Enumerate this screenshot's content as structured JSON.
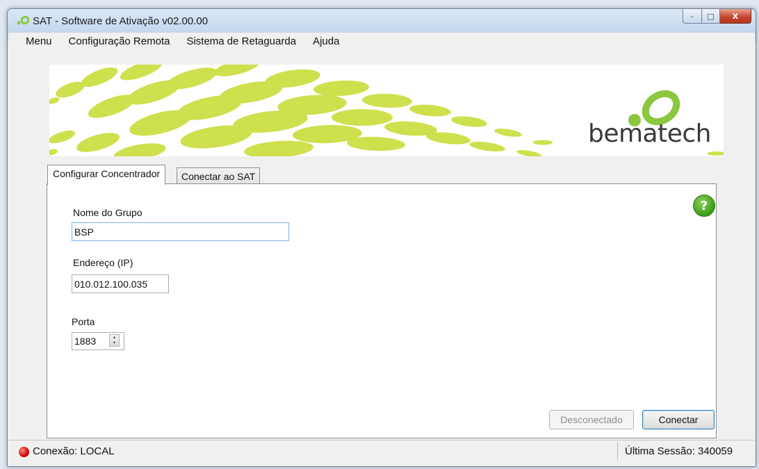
{
  "window": {
    "title": "SAT - Software de Ativação v02.00.00",
    "controls": {
      "minimize": "–",
      "maximize": "□",
      "close": "x"
    }
  },
  "menu": {
    "items": [
      {
        "label": "Menu"
      },
      {
        "label": "Configuração Remota"
      },
      {
        "label": "Sistema de Retaguarda"
      },
      {
        "label": "Ajuda"
      }
    ]
  },
  "banner": {
    "brand": "bematech",
    "accent_color": "#c8dc3c"
  },
  "tabs": [
    {
      "label": "Configurar Concentrador",
      "selected": true
    },
    {
      "label": "Conectar ao SAT",
      "selected": false
    }
  ],
  "form": {
    "group_name": {
      "label": "Nome do Grupo",
      "value": "BSP"
    },
    "ip_address": {
      "label": "Endereço (IP)",
      "value": "010.012.100.035"
    },
    "port": {
      "label": "Porta",
      "value": "1883"
    }
  },
  "help": {
    "symbol": "?",
    "icon": "help-icon",
    "color": "#3a9a1a"
  },
  "buttons": {
    "disconnect": "Desconectado",
    "connect": "Conectar"
  },
  "status": {
    "connection": "Conexão: LOCAL",
    "connection_icon": "red-status-icon",
    "last_session": "Última Sessão: 340059"
  }
}
